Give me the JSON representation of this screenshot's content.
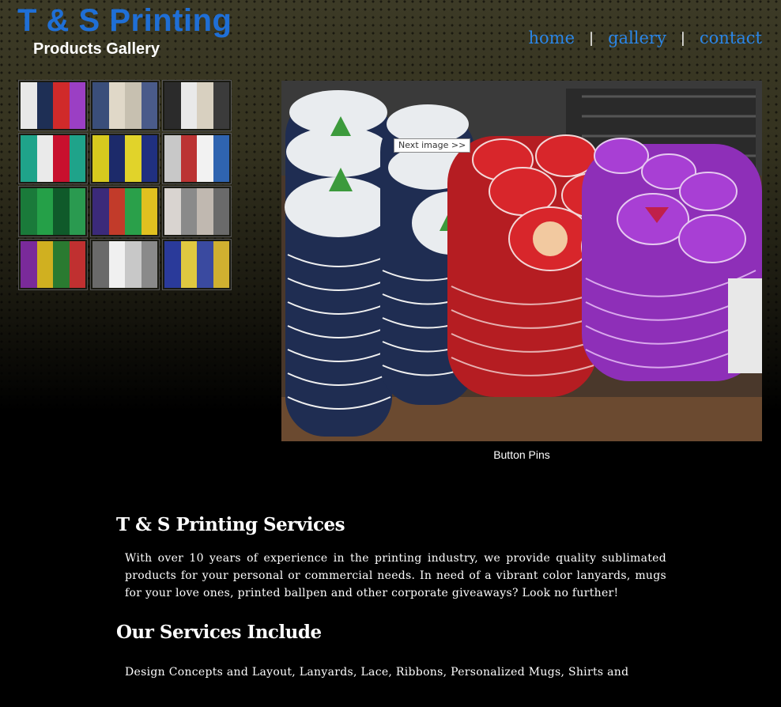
{
  "header": {
    "title": "T & S Printing",
    "subtitle": "Products Gallery"
  },
  "nav": {
    "items": [
      {
        "label": "home"
      },
      {
        "label": "gallery"
      },
      {
        "label": "contact"
      }
    ],
    "separator": "|"
  },
  "gallery": {
    "next_label": "Next image >>",
    "caption": "Button Pins",
    "thumbnails": [
      {
        "colors": [
          "#e8e8e8",
          "#1e2f55",
          "#d02a2a",
          "#9b3fc4"
        ]
      },
      {
        "colors": [
          "#3a4e7a",
          "#e0d8c8",
          "#c7c0b0",
          "#4a5b8a"
        ]
      },
      {
        "colors": [
          "#2b2b2b",
          "#e9e9e9",
          "#d8d0c0",
          "#3b3b3b"
        ]
      },
      {
        "colors": [
          "#1fa38a",
          "#eaeaea",
          "#c8102e",
          "#1fa38a"
        ]
      },
      {
        "colors": [
          "#d7c91e",
          "#1c2a6a",
          "#e1d32a",
          "#203080"
        ]
      },
      {
        "colors": [
          "#c8c8c8",
          "#b33",
          "#f2f2f2",
          "#2f64b0"
        ]
      },
      {
        "colors": [
          "#1a7a3a",
          "#25a048",
          "#0f5a2a",
          "#2a9a50"
        ]
      },
      {
        "colors": [
          "#3b2a7a",
          "#c23b2a",
          "#2aa04a",
          "#e0c020"
        ]
      },
      {
        "colors": [
          "#d9d4d0",
          "#8a8a8a",
          "#c0b8b0",
          "#6a6a6a"
        ]
      },
      {
        "colors": [
          "#7a2a9a",
          "#d0b020",
          "#2a7a30",
          "#c03030"
        ]
      },
      {
        "colors": [
          "#6a6a6a",
          "#f0f0f0",
          "#c8c8c8",
          "#8a8a8a"
        ]
      },
      {
        "colors": [
          "#2a3a9a",
          "#e0c840",
          "#3a4aa0",
          "#d0b030"
        ]
      }
    ]
  },
  "services": {
    "heading": "T & S Printing Services",
    "intro": "With over 10 years of experience in the printing industry, we provide quality sublimated products for your personal or commercial needs. In need of a vibrant color lanyards, mugs for your love ones, printed ballpen and other corporate giveaways? Look no further!",
    "include_heading": "Our Services Include",
    "include_text": "Design Concepts and Layout, Lanyards, Lace, Ribbons, Personalized Mugs, Shirts and"
  }
}
